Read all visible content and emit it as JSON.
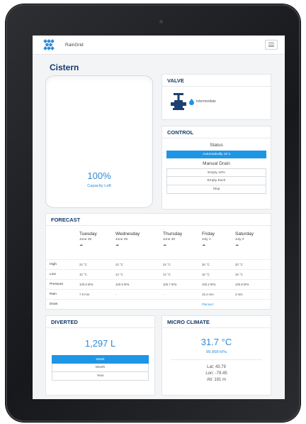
{
  "app": {
    "brand": "RainGrid",
    "page_title": "Cistern"
  },
  "cistern": {
    "capacity_value": "100%",
    "capacity_label": "Capacity Left",
    "capacity_fraction": 1.0
  },
  "valve": {
    "title": "VALVE",
    "state": "Intermediate",
    "icon": "valve-icon"
  },
  "control": {
    "title": "CONTROL",
    "status_label": "Status",
    "status_value": "Automatically 10 s",
    "manual_label": "Manual Drain",
    "buttons": [
      "Empty 10%",
      "Empty Each",
      "Stop"
    ]
  },
  "forecast": {
    "title": "FORECAST",
    "days": [
      {
        "name": "Tuesday",
        "date": "June 28",
        "icon": "cloud-icon",
        "high": "22 °C",
        "low": "10 °C",
        "pressure": "100.8 kPa",
        "rain": "7.9 mm",
        "drain": ""
      },
      {
        "name": "Wednesday",
        "date": "June 29",
        "icon": "cloud-icon",
        "high": "22 °C",
        "low": "14 °C",
        "pressure": "100.9 kPa",
        "rain": "-",
        "drain": ""
      },
      {
        "name": "Thursday",
        "date": "June 30",
        "icon": "cloud-icon",
        "high": "24 °C",
        "low": "14 °C",
        "pressure": "100.7 kPa",
        "rain": "-",
        "drain": ""
      },
      {
        "name": "Friday",
        "date": "July 1",
        "icon": "cloud-icon",
        "high": "26 °C",
        "low": "16 °C",
        "pressure": "100.2 kPa",
        "rain": "15.4 mm",
        "drain": "Planned"
      },
      {
        "name": "Saturday",
        "date": "July 2",
        "icon": "cloud-icon",
        "high": "20 °C",
        "low": "16 °C",
        "pressure": "100.8 kPa",
        "rain": "3 mm",
        "drain": ""
      }
    ],
    "row_labels": {
      "high": "High",
      "low": "Low",
      "pressure": "Pressure",
      "rain": "Rain",
      "drain": "Drain"
    }
  },
  "diverted": {
    "title": "DIVERTED",
    "value": "1,297 L",
    "buttons": [
      {
        "label": "Week",
        "active": true
      },
      {
        "label": "Month",
        "active": false
      },
      {
        "label": "Year",
        "active": false
      }
    ]
  },
  "micro_climate": {
    "title": "MICRO CLIMATE",
    "temperature": "31.7 °C",
    "pressure": "99.958 kPa",
    "lat": "Lat: 43.79",
    "lon": "Lon: -79.45",
    "alt": "Alt: 191 m"
  },
  "colors": {
    "accent": "#1f95e6",
    "heading": "#15396a",
    "value": "#2f8bd6"
  }
}
